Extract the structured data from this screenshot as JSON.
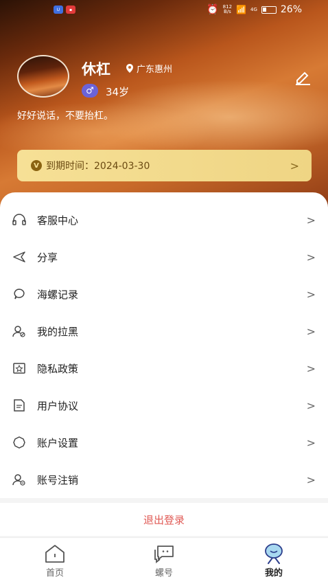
{
  "status_bar": {
    "speed_top": "812",
    "speed_bottom": "B/s",
    "network": "4G",
    "battery": "26%"
  },
  "profile": {
    "nickname": "休杠",
    "location": "广东惠州",
    "gender_symbol": "♂",
    "age": "34岁",
    "bio": "好好说话，不要抬杠。"
  },
  "vip": {
    "icon_letter": "V",
    "text": "到期时间：2024-03-30"
  },
  "menu": [
    {
      "label": "客服中心",
      "icon": "headset-icon"
    },
    {
      "label": "分享",
      "icon": "share-icon"
    },
    {
      "label": "海螺记录",
      "icon": "chat-bubble-icon"
    },
    {
      "label": "我的拉黑",
      "icon": "user-block-icon"
    },
    {
      "label": "隐私政策",
      "icon": "privacy-icon"
    },
    {
      "label": "用户协议",
      "icon": "document-icon"
    },
    {
      "label": "账户设置",
      "icon": "settings-icon"
    },
    {
      "label": "账号注销",
      "icon": "user-remove-icon"
    }
  ],
  "logout_label": "退出登录",
  "tabs": [
    {
      "label": "首页",
      "icon": "home-icon"
    },
    {
      "label": "螺号",
      "icon": "messages-icon"
    },
    {
      "label": "我的",
      "icon": "profile-icon"
    }
  ],
  "colors": {
    "accent_purple": "#6b63d8",
    "vip_gold": "#efd584",
    "logout_red": "#e05a55"
  }
}
